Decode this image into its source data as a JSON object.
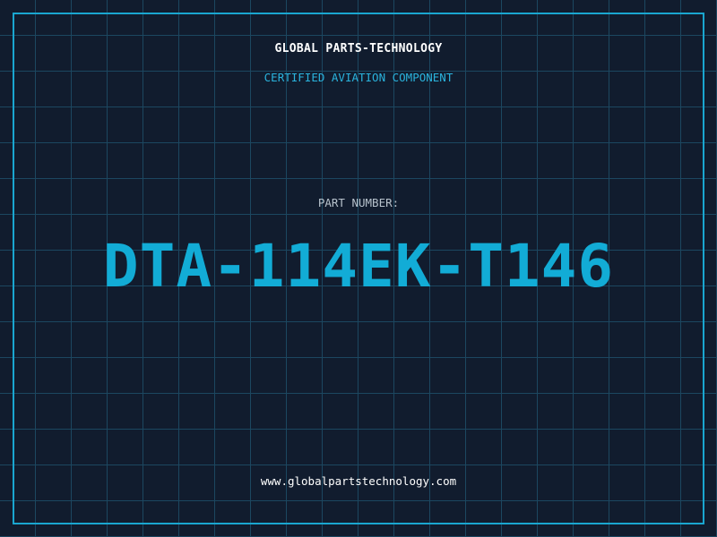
{
  "header": {
    "company": "GLOBAL PARTS-TECHNOLOGY",
    "subtitle": "CERTIFIED AVIATION COMPONENT"
  },
  "main": {
    "label": "PART NUMBER:",
    "part_number": "DTA-114EK-T146"
  },
  "footer": {
    "website": "www.globalpartstechnology.com"
  },
  "colors": {
    "background": "#111c2e",
    "grid": "#1c4760",
    "accent": "#12acd6",
    "text": "#ffffff"
  }
}
